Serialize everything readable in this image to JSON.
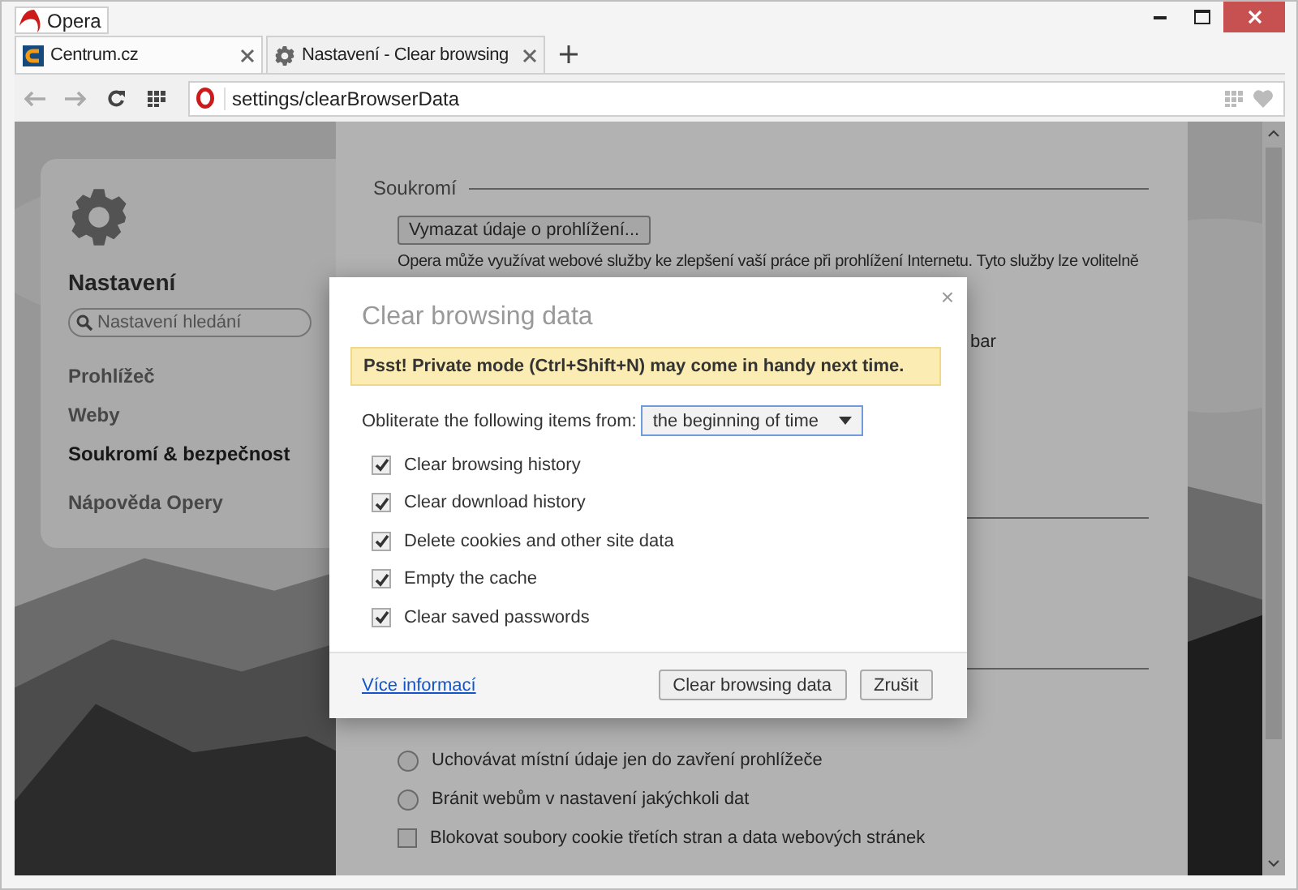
{
  "window": {
    "app_button": "Opera"
  },
  "tabs": [
    {
      "title": "Centrum.cz",
      "selected": false,
      "kind": "site"
    },
    {
      "title": "Nastavení - Clear browsing",
      "selected": true,
      "kind": "settings"
    }
  ],
  "address_bar": {
    "value": "settings/clearBrowserData"
  },
  "sidebar": {
    "title": "Nastavení",
    "search": {
      "placeholder": "Nastavení hledání"
    },
    "items": [
      {
        "label": "Prohlížeč",
        "selected": false
      },
      {
        "label": "Weby",
        "selected": false
      },
      {
        "label": "Soukromí & bezpečnost",
        "selected": true
      },
      {
        "label": "Nápověda Opery",
        "selected": false
      }
    ]
  },
  "content": {
    "section_title": "Soukromí",
    "button": "Vymazat údaje o prohlížení...",
    "description": "Opera může využívat webové služby ke zlepšení vaší práce při prohlížení Internetu. Tyto služby lze volitelně",
    "fragment": "bar",
    "options": [
      {
        "kind": "radio",
        "label": "Uchovávat místní údaje jen do zavření prohlížeče",
        "checked": false
      },
      {
        "kind": "radio",
        "label": "Bránit webům v nastavení jakýchkoli dat",
        "checked": false
      },
      {
        "kind": "checkbox",
        "label": "Blokovat soubory cookie třetích stran a data webových stránek",
        "checked": false
      }
    ]
  },
  "dialog": {
    "title": "Clear browsing data",
    "close": "×",
    "notice": "Psst! Private mode (Ctrl+Shift+N) may come in handy next time.",
    "range_label": "Obliterate the following items from:",
    "range_value": "the beginning of time",
    "items": [
      {
        "label": "Clear browsing history",
        "checked": true
      },
      {
        "label": "Clear download history",
        "checked": true
      },
      {
        "label": "Delete cookies and other site data",
        "checked": true
      },
      {
        "label": "Empty the cache",
        "checked": true
      },
      {
        "label": "Clear saved passwords",
        "checked": true
      }
    ],
    "link": "Více informací",
    "buttons": [
      "Clear browsing data",
      "Zrušit"
    ]
  }
}
